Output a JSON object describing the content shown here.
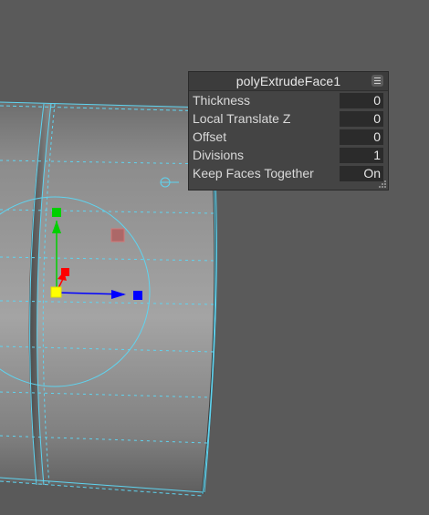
{
  "panel": {
    "title": "polyExtrudeFace1",
    "menu_icon": "hamburger-menu-icon",
    "rows": [
      {
        "label": "Thickness",
        "value": "0"
      },
      {
        "label": "Local Translate Z",
        "value": "0"
      },
      {
        "label": "Offset",
        "value": "0"
      },
      {
        "label": "Divisions",
        "value": "1"
      },
      {
        "label": "Keep Faces Together",
        "value": "On"
      }
    ]
  },
  "colors": {
    "background": "#5a5a5a",
    "wireframe": "#5fd4f0",
    "axis_y": "#00d000",
    "axis_x": "#0000ff",
    "axis_z": "#ff0000",
    "center": "#ffff00"
  }
}
